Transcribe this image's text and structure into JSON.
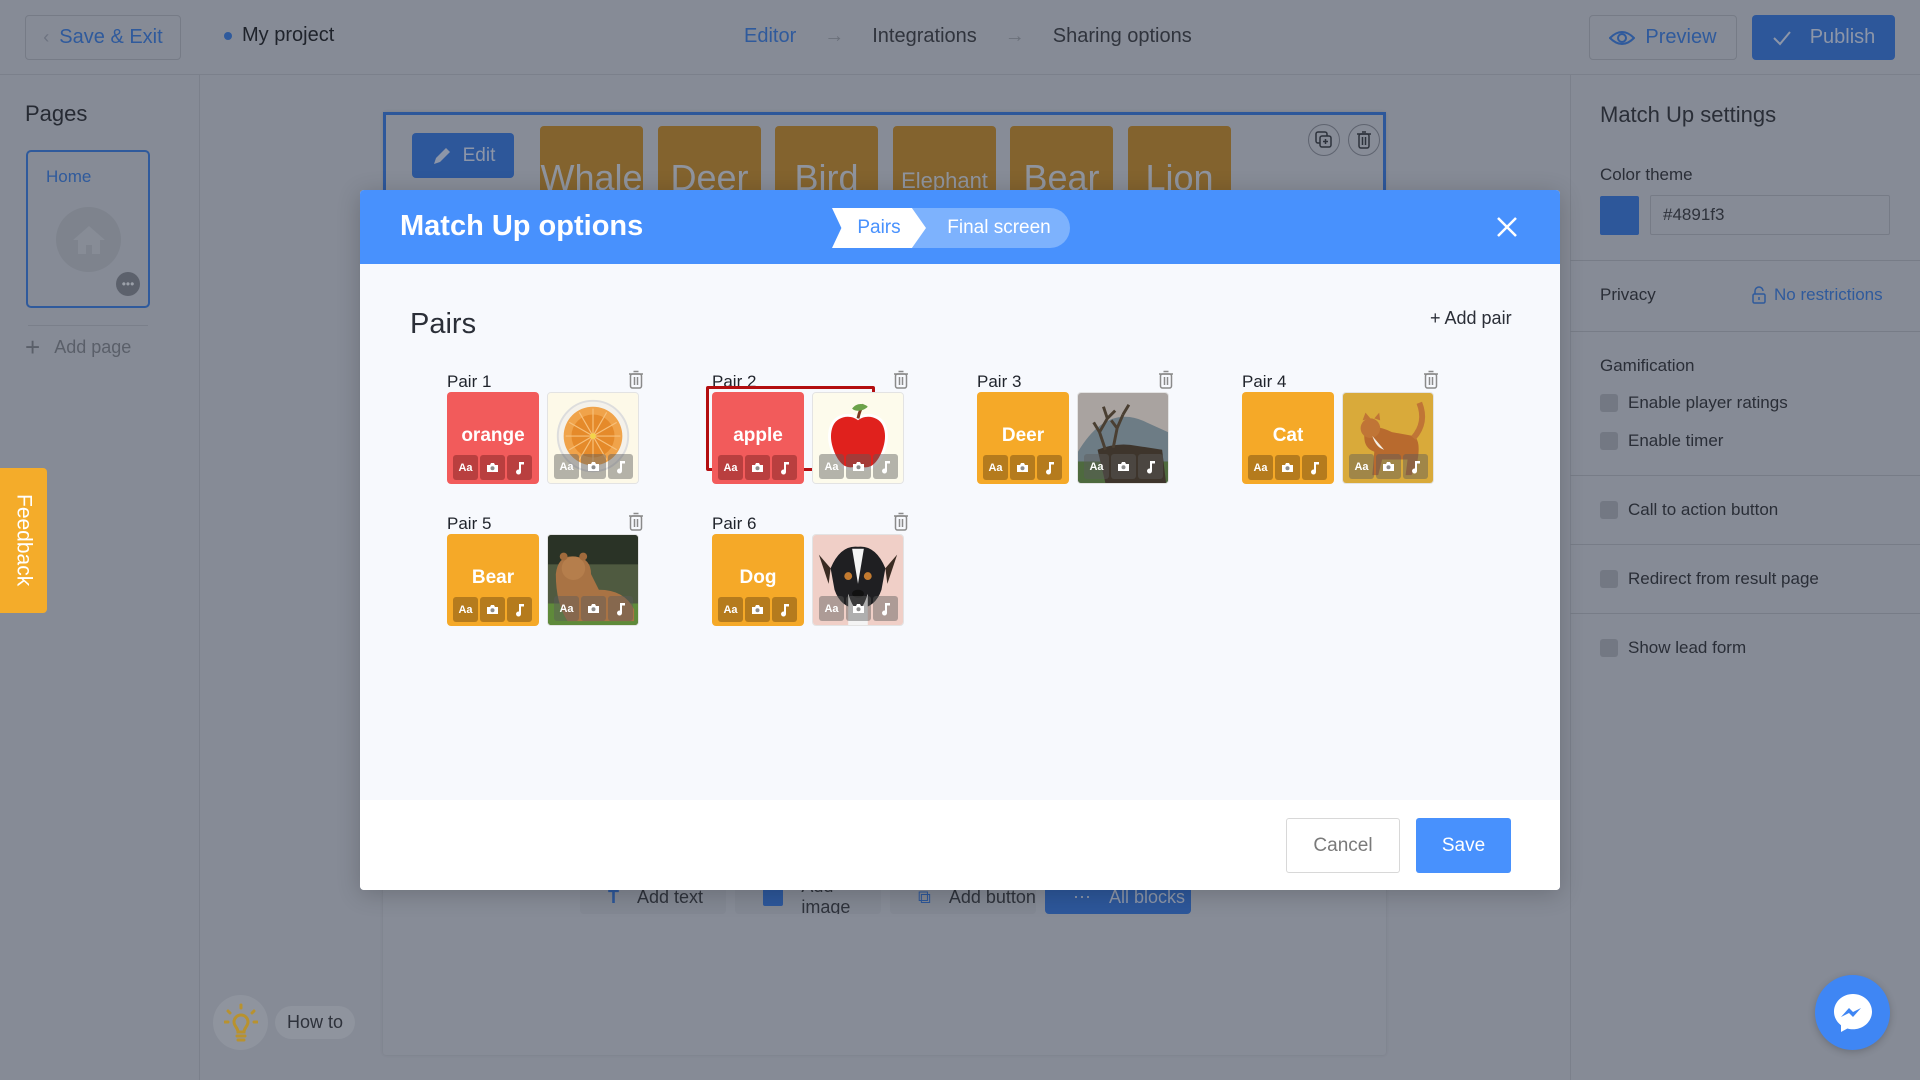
{
  "topbar": {
    "save_exit_label": "Save & Exit",
    "project_name": "My project",
    "steps": [
      {
        "label": "Editor",
        "active": true
      },
      {
        "label": "Integrations",
        "active": false
      },
      {
        "label": "Sharing options",
        "active": false
      }
    ],
    "preview_label": "Preview",
    "publish_label": "Publish"
  },
  "sidebar": {
    "title": "Pages",
    "pages": [
      {
        "label": "Home"
      }
    ],
    "add_page_label": "Add page"
  },
  "feedback_label": "Feedback",
  "howto_label": "How to",
  "canvas": {
    "edit_label": "Edit",
    "words": [
      "Whale",
      "Deer",
      "Bird",
      "Elephant",
      "Bear",
      "Lion"
    ],
    "add_blocks": [
      "Add text",
      "Add image",
      "Add button",
      "All blocks"
    ]
  },
  "settings": {
    "title": "Match Up settings",
    "color_theme_label": "Color theme",
    "color_theme_value": "#4891f3",
    "privacy_label": "Privacy",
    "privacy_value": "No restrictions",
    "gamification_label": "Gamification",
    "options": [
      {
        "label": "Enable player ratings",
        "checked": false
      },
      {
        "label": "Enable timer",
        "checked": false
      },
      {
        "label": "Call to action button",
        "checked": false
      },
      {
        "label": "Redirect from result page",
        "checked": false
      },
      {
        "label": "Show lead form",
        "checked": false
      }
    ]
  },
  "modal": {
    "title": "Match Up options",
    "tabs": [
      {
        "label": "Pairs",
        "active": true
      },
      {
        "label": "Final screen",
        "active": false
      }
    ],
    "section_title": "Pairs",
    "add_pair_label": "+ Add pair",
    "pairs": [
      {
        "label": "Pair 1",
        "word": "orange",
        "color": "red",
        "image": "orange",
        "selected": false
      },
      {
        "label": "Pair 2",
        "word": "apple",
        "color": "red",
        "image": "apple",
        "selected": true
      },
      {
        "label": "Pair 3",
        "word": "Deer",
        "color": "yellow",
        "image": "deer",
        "selected": false
      },
      {
        "label": "Pair 4",
        "word": "Cat",
        "color": "yellow",
        "image": "cat",
        "selected": false
      },
      {
        "label": "Pair 5",
        "word": "Bear",
        "color": "yellow",
        "image": "bear",
        "selected": false
      },
      {
        "label": "Pair 6",
        "word": "Dog",
        "color": "yellow",
        "image": "dog",
        "selected": false
      }
    ],
    "tile_tools": [
      "Aa",
      "camera-icon",
      "music-note-icon"
    ],
    "cancel_label": "Cancel",
    "save_label": "Save"
  },
  "colors": {
    "accent": "#4891fd",
    "red_tile": "#f25b5b",
    "yellow_tile": "#f5a928",
    "selected_border": "#b30e10",
    "feedback": "#f4ac2a"
  }
}
